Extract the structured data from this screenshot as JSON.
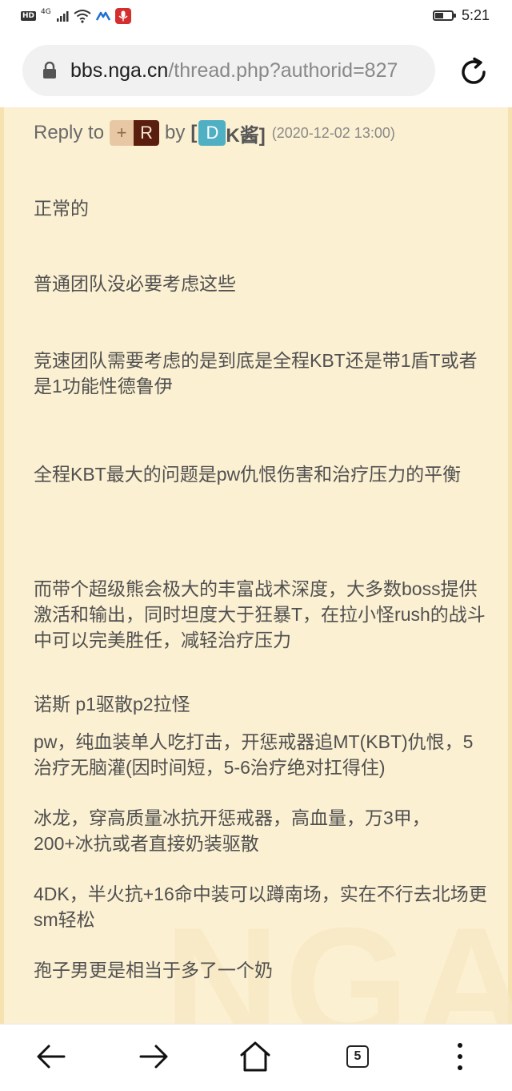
{
  "status_bar": {
    "hd": "HD",
    "network": "4G",
    "time": "5:21",
    "battery_level": 0.45
  },
  "address_bar": {
    "host": "bbs.nga.cn",
    "path": "/thread.php?authorid=827"
  },
  "post": {
    "reply_prefix": "Reply to",
    "reply_badge_plus": "+",
    "reply_badge_letter": "R",
    "by_label": "by",
    "bracket_open": "[",
    "author_badge_letter": "D",
    "author_name": "K酱]",
    "date": "(2020-12-02 13:00)",
    "paragraphs": [
      "正常的",
      "普通团队没必要考虑这些",
      "竞速团队需要考虑的是到底是全程KBT还是带1盾T或者是1功能性德鲁伊",
      "全程KBT最大的问题是pw仇恨伤害和治疗压力的平衡",
      "而带个超级熊会极大的丰富战术深度，大多数boss提供激活和输出，同时坦度大于狂暴T，在拉小怪rush的战斗中可以完美胜任，减轻治疗压力"
    ],
    "lines": [
      "诺斯 p1驱散p2拉怪",
      "pw，纯血装单人吃打击，开惩戒器追MT(KBT)仇恨，5治疗无脑灌(因时间短，5-6治疗绝对扛得住)",
      "冰龙，穿高质量冰抗开惩戒器，高血量，万3甲，200+冰抗或者直接奶装驱散",
      "4DK，半火抗+16命中装可以蹲南场，实在不行去北场更sm轻松",
      "孢子男更是相当于多了一个奶"
    ],
    "watermark": "NGA"
  },
  "bottom_nav": {
    "tab_count": "5"
  },
  "colors": {
    "content_bg": "#fcf0d2",
    "author_badge": "#4fb0c4",
    "reply_badge_dark": "#5a1e0e",
    "recording_indicator": "#d32f2f"
  }
}
